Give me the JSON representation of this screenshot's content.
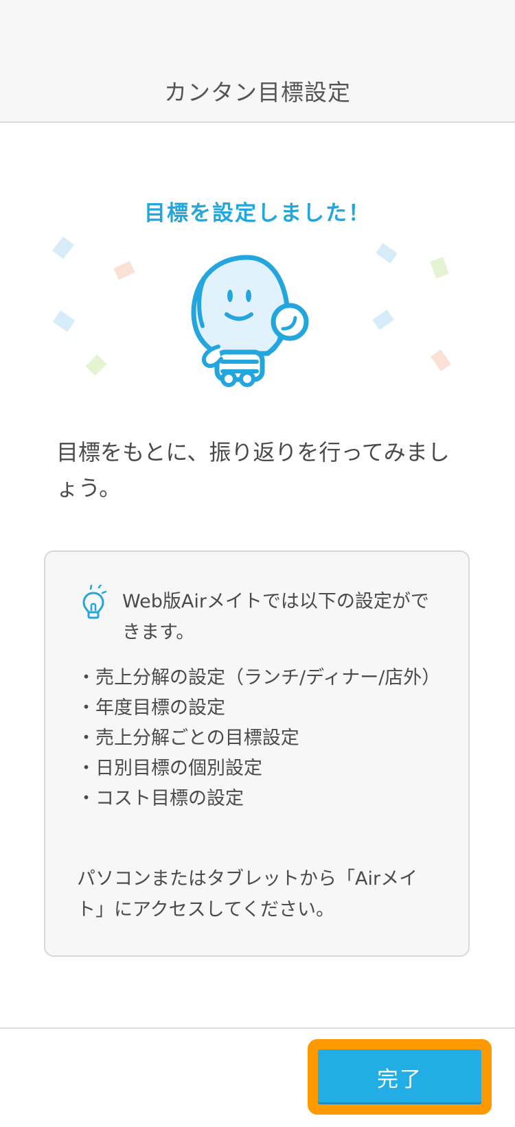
{
  "header": {
    "title": "カンタン目標設定"
  },
  "success": {
    "title": "目標を設定しました！"
  },
  "message": {
    "text": "目標をもとに、振り返りを行ってみましょう。"
  },
  "info": {
    "tip": "Web版Airメイトでは以下の設定ができます。",
    "items": [
      "・売上分解の設定（ランチ/ディナー/店外）",
      "・年度目標の設定",
      "・売上分解ごとの目標設定",
      "・日別目標の個別設定",
      "・コスト目標の設定"
    ],
    "access": "パソコンまたはタブレットから「Airメイト」にアクセスしてください。"
  },
  "footer": {
    "done_label": "完了"
  },
  "colors": {
    "accent": "#22a6dd",
    "button": "#22ade5",
    "highlight": "#ff9900"
  },
  "icons": {
    "tip": "lightbulb-icon",
    "mascot": "lightbulb-mascot"
  }
}
